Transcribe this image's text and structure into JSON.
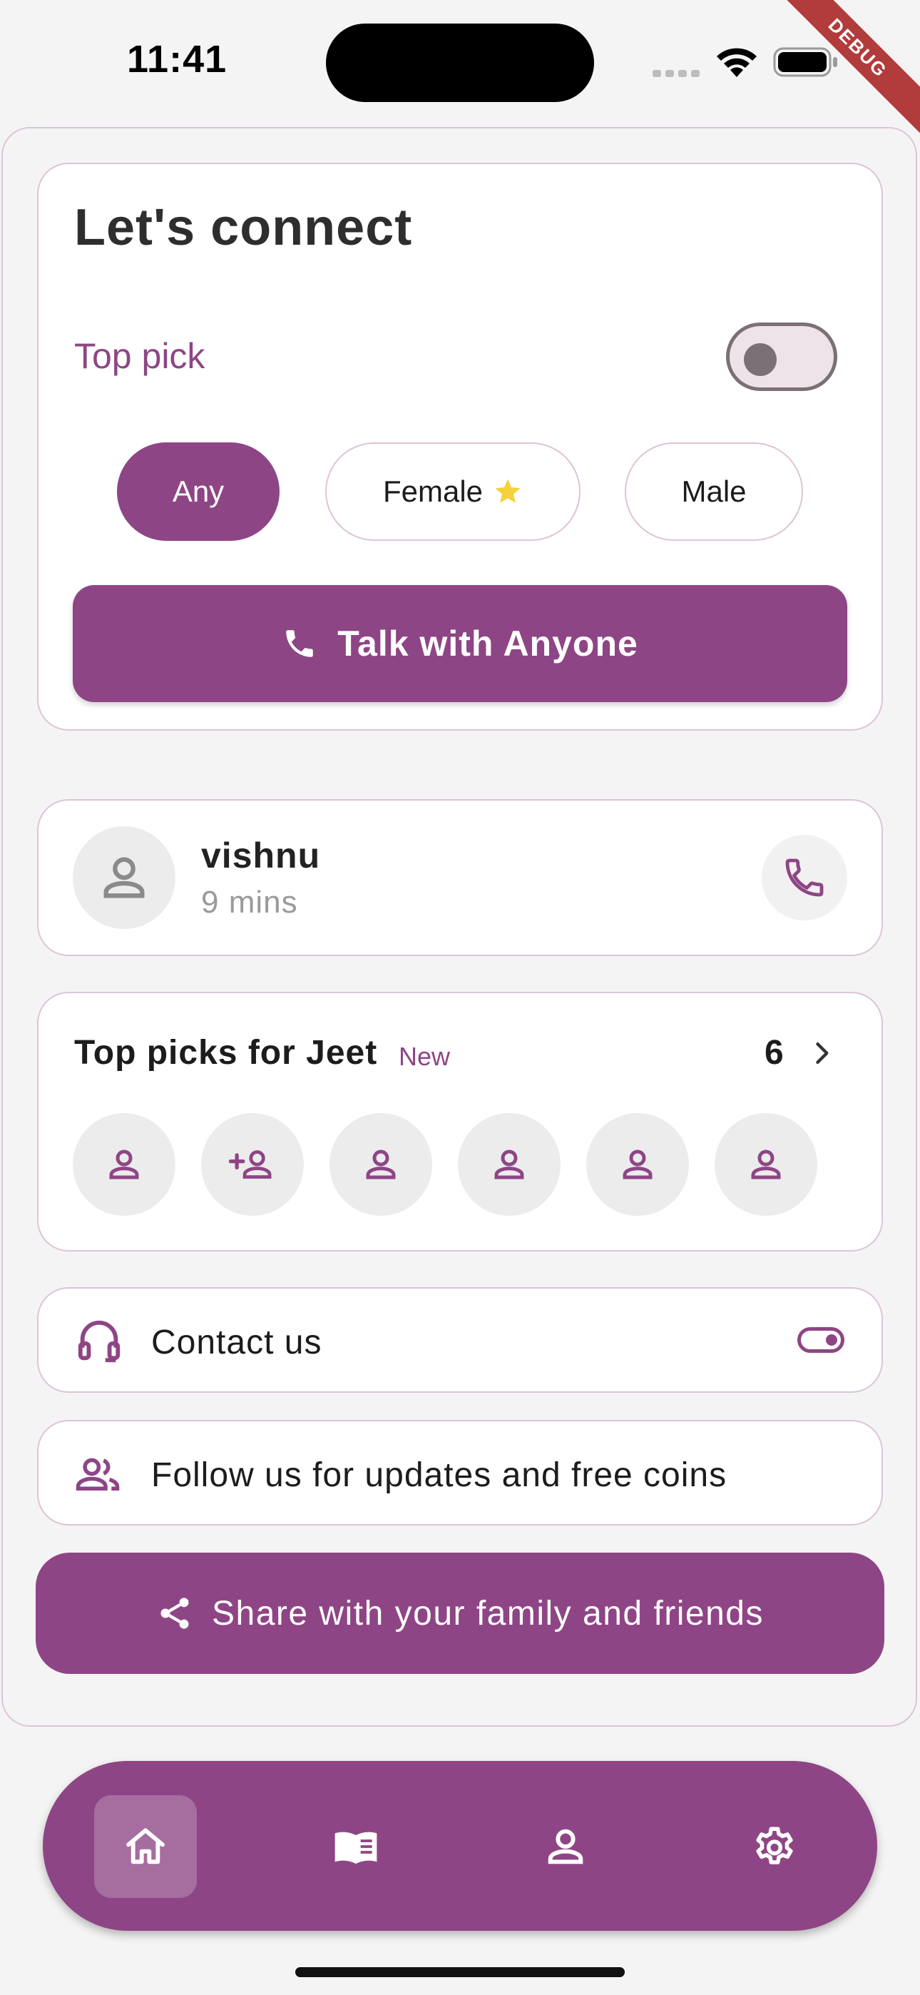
{
  "status_bar": {
    "time": "11:41",
    "debug_banner": "DEBUG"
  },
  "connect": {
    "title": "Let's connect",
    "top_pick_label": "Top pick",
    "top_pick_enabled": false,
    "gender_options": [
      {
        "label": "Any",
        "selected": true
      },
      {
        "label": "Female",
        "selected": false,
        "icon": "star-icon"
      },
      {
        "label": "Male",
        "selected": false
      }
    ],
    "talk_button_label": "Talk with Anyone"
  },
  "recent_call": {
    "name": "vishnu",
    "duration": "9 mins"
  },
  "top_picks": {
    "title": "Top picks for Jeet",
    "badge": "New",
    "count": "6",
    "avatars": [
      "person-icon",
      "person-add-icon",
      "person-icon",
      "person-icon",
      "person-icon",
      "person-icon"
    ]
  },
  "rows": {
    "contact_label": "Contact us",
    "follow_label": "Follow us for updates and free coins"
  },
  "share_button_label": "Share with your family and friends",
  "bottom_nav": {
    "items": [
      {
        "icon": "home-icon",
        "active": true
      },
      {
        "icon": "book-icon",
        "active": false
      },
      {
        "icon": "person-icon",
        "active": false
      },
      {
        "icon": "gear-icon",
        "active": false
      }
    ]
  },
  "colors": {
    "accent": "#8e4585",
    "card_border": "#dcc4d8",
    "background": "#f4f4f4",
    "star": "#f5d23a"
  }
}
